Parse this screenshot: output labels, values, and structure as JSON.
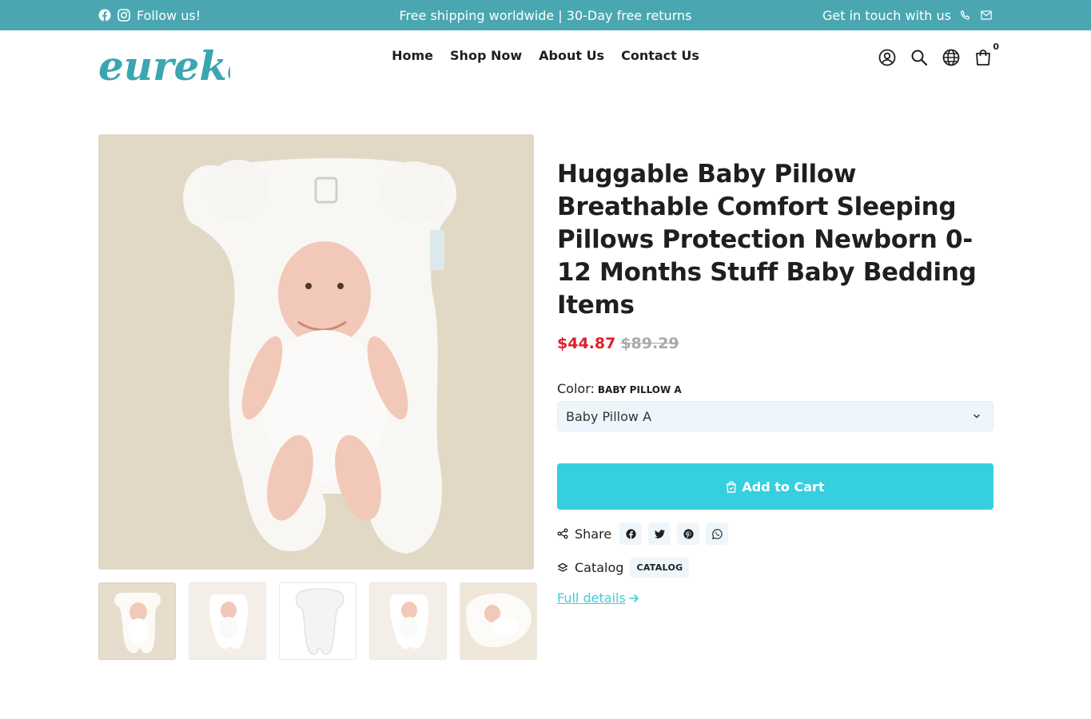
{
  "announcement": {
    "follow": "Follow us!",
    "center": "Free shipping worldwide | 30-Day free returns",
    "contact": "Get in touch with us"
  },
  "header": {
    "logo_text": "eureka!",
    "nav": [
      "Home",
      "Shop Now",
      "About Us",
      "Contact Us"
    ],
    "cart_count": "0"
  },
  "product": {
    "title": "Huggable Baby Pillow Breathable Comfort Sleeping Pillows Protection Newborn 0-12 Months Stuff Baby Bedding Items",
    "price": "$44.87",
    "compare_price": "$89.29",
    "color_label": "Color:",
    "color_value": "Baby Pillow A",
    "color_options": [
      "Baby Pillow A"
    ],
    "add_to_cart": "Add to Cart",
    "share_label": "Share",
    "share_icons": [
      "facebook-icon",
      "twitter-icon",
      "pinterest-icon",
      "whatsapp-icon"
    ],
    "catalog_label": "Catalog",
    "catalog_tag": "CATALOG",
    "full_details": "Full details"
  },
  "colors": {
    "topbar": "#4aa7b2",
    "accent": "#36cfdf",
    "price": "#e0202a",
    "logo": "#3aa6b0"
  }
}
